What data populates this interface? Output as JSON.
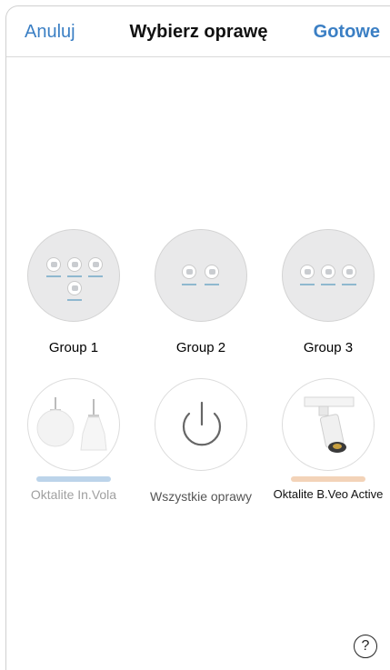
{
  "nav": {
    "cancel_label": "Anuluj",
    "title": "Wybierz oprawę",
    "done_label": "Gotowe"
  },
  "groups": [
    {
      "label": "Group 1",
      "icon": "group-lights-icon",
      "count": 4
    },
    {
      "label": "Group 2",
      "icon": "group-lights-icon",
      "count": 2
    },
    {
      "label": "Group 3",
      "icon": "group-lights-icon",
      "count": 3
    }
  ],
  "fixtures": [
    {
      "label": "Oktalite In.Vola",
      "icon": "pendant-lamps-icon",
      "bar_color": "#bcd4ea",
      "label_color": "#a0a0a0"
    },
    {
      "label": "Wszystkie oprawy",
      "icon": "power-icon",
      "label_color": "#555555"
    },
    {
      "label": "Oktalite B.Veo Active",
      "icon": "track-spotlight-icon",
      "bar_color": "#f3d3b8",
      "label_color": "#111111"
    }
  ],
  "help": {
    "symbol": "?",
    "icon": "help-icon"
  },
  "colors": {
    "accent": "#3b7fc4"
  }
}
